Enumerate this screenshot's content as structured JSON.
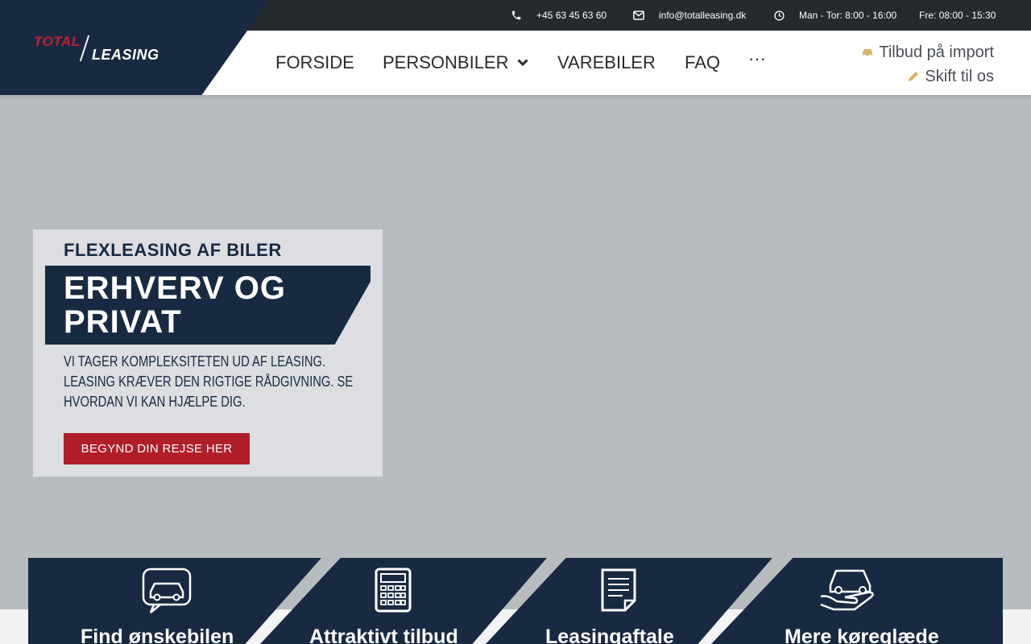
{
  "topbar": {
    "phone": "+45 63 45 63 60",
    "email": "info@totalleasing.dk",
    "hours_weekdays": "Man - Tor: 8:00 - 16:00",
    "hours_friday": "Fre: 08:00 - 15:30"
  },
  "logo": {
    "part1": "TOTAL",
    "part2": "LEASING"
  },
  "nav": {
    "items": [
      {
        "label": "FORSIDE"
      },
      {
        "label": "PERSONBILER"
      },
      {
        "label": "VAREBILER"
      },
      {
        "label": "FAQ"
      },
      {
        "label": "···"
      }
    ]
  },
  "side_links": {
    "import": "Tilbud på import",
    "switch": "Skift til os"
  },
  "hero": {
    "subtitle": "FLEXLEASING AF BILER",
    "title": "ERHVERV OG PRIVAT",
    "description": "Vi tager kompleksiteten ud af leasing. Leasing kræver den rigtige rådgivning. Se hvordan vi kan hjælpe dig.",
    "button": "BEGYND DIN REJSE HER"
  },
  "features": [
    {
      "title": "Find ønskebilen",
      "icon": "car-chat-icon"
    },
    {
      "title": "Attraktivt tilbud",
      "icon": "calculator-icon"
    },
    {
      "title": "Leasingaftale",
      "icon": "document-icon"
    },
    {
      "title": "Mere køreglæde",
      "icon": "car-hand-icon"
    }
  ],
  "colors": {
    "navy": "#182a42",
    "red": "#b01e2a",
    "topbar": "#26292d",
    "accent_gold": "#d9b46a"
  }
}
